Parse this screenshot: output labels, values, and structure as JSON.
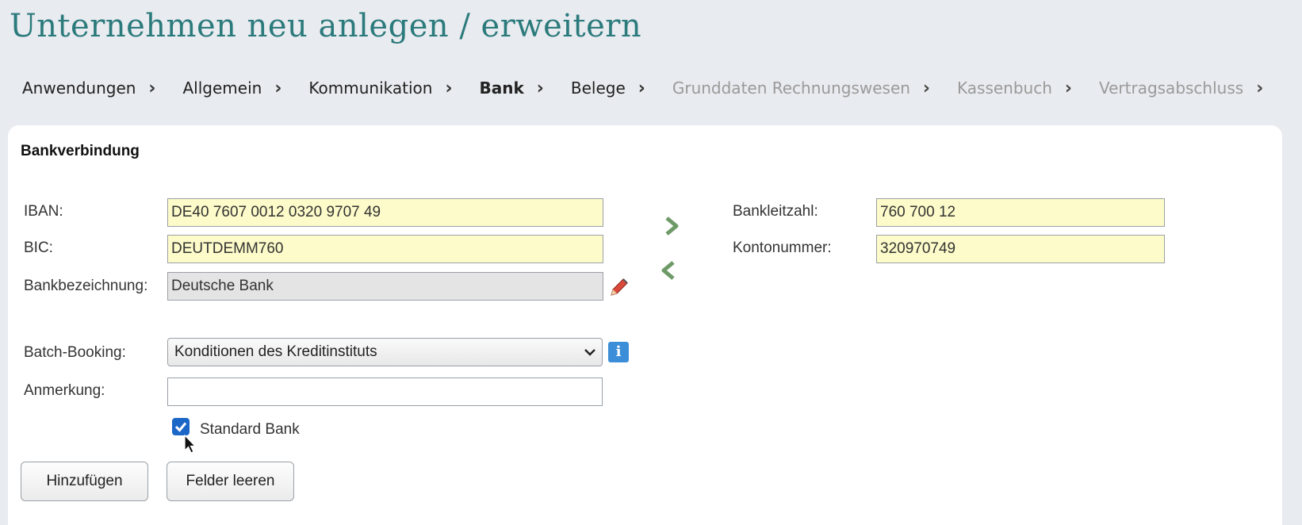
{
  "page": {
    "title": "Unternehmen neu anlegen / erweitern"
  },
  "wizard": {
    "steps": [
      {
        "label": "Anwendungen",
        "state": "done"
      },
      {
        "label": "Allgemein",
        "state": "done"
      },
      {
        "label": "Kommunikation",
        "state": "done"
      },
      {
        "label": "Bank",
        "state": "active"
      },
      {
        "label": "Belege",
        "state": "done"
      },
      {
        "label": "Grunddaten Rechnungswesen",
        "state": "disabled"
      },
      {
        "label": "Kassenbuch",
        "state": "disabled"
      },
      {
        "label": "Vertragsabschluss",
        "state": "disabled"
      }
    ]
  },
  "form": {
    "section_title": "Bankverbindung",
    "iban": {
      "label": "IBAN:",
      "value": "DE40 7607 0012 0320 9707 49"
    },
    "bic": {
      "label": "BIC:",
      "value": "DEUTDEMM760"
    },
    "bankname": {
      "label": "Bankbezeichnung:",
      "value": "Deutsche Bank"
    },
    "blz": {
      "label": "Bankleitzahl:",
      "value": "760 700 12"
    },
    "konto": {
      "label": "Kontonummer:",
      "value": "320970749"
    },
    "batch": {
      "label": "Batch-Booking:",
      "value": "Konditionen des Kreditinstituts"
    },
    "anmerkung": {
      "label": "Anmerkung:",
      "value": ""
    },
    "standard": {
      "label": "Standard Bank",
      "checked": true
    }
  },
  "buttons": {
    "add": "Hinzufügen",
    "clear": "Felder leeren"
  },
  "icons": {
    "convert_right": "chevron-right-icon",
    "convert_left": "chevron-left-icon",
    "edit": "pencil-icon",
    "info": "info-icon",
    "info_glyph": "i"
  },
  "colors": {
    "title": "#2b7a7c",
    "field_bg": "#fdfbc9",
    "readonly_bg": "#e4e4e4",
    "checkbox": "#1a67c7",
    "info": "#3c8ed8",
    "arrow": "#6e9a68"
  }
}
